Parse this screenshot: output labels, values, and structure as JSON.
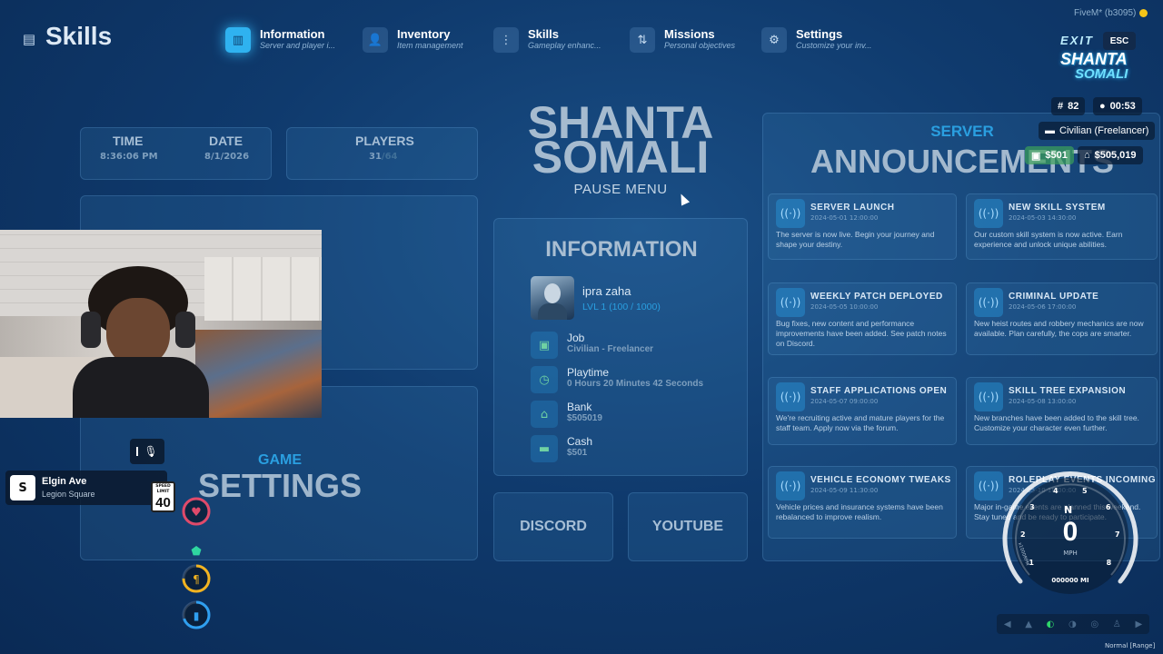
{
  "header": {
    "title": "Skills"
  },
  "nav": [
    {
      "label": "Information",
      "sub": "Server and player i...",
      "icon": "map-icon",
      "active": true
    },
    {
      "label": "Inventory",
      "sub": "Item management",
      "icon": "user-icon",
      "active": false
    },
    {
      "label": "Skills",
      "sub": "Gameplay enhanc...",
      "icon": "skills-icon",
      "active": false
    },
    {
      "label": "Missions",
      "sub": "Personal objectives",
      "icon": "route-icon",
      "active": false
    },
    {
      "label": "Settings",
      "sub": "Customize your inv...",
      "icon": "gear-icon",
      "active": false
    }
  ],
  "stats": {
    "time_label": "TIME",
    "time_value": "8:36:06 PM",
    "date_label": "DATE",
    "date_value": "8/1/2026",
    "players_label": "PLAYERS",
    "players_value": "31",
    "players_max": "/64"
  },
  "brand": {
    "line1": "SHANTA",
    "line2": "SOMALI",
    "subtitle": "PAUSE MENU"
  },
  "info": {
    "title": "INFORMATION",
    "name": "ipra zaha",
    "level": "LVL 1 (100 / 1000)",
    "rows": [
      {
        "label": "Job",
        "value": "Civilian - Freelancer",
        "icon": "briefcase-icon"
      },
      {
        "label": "Playtime",
        "value": "0 Hours 20 Minutes 42 Seconds",
        "icon": "clock-icon"
      },
      {
        "label": "Bank",
        "value": "$505019",
        "icon": "bank-icon"
      },
      {
        "label": "Cash",
        "value": "$501",
        "icon": "cash-icon"
      }
    ]
  },
  "links": {
    "discord": "DISCORD",
    "youtube": "YOUTUBE"
  },
  "game_settings": {
    "small": "GAME",
    "big": "SETTINGS"
  },
  "announcements": {
    "small": "SERVER",
    "big": "ANNOUNCEMENTS",
    "items": [
      {
        "title": "SERVER LAUNCH",
        "date": "2024-05-01 12:00:00",
        "body": "The server is now live. Begin your journey and shape your destiny."
      },
      {
        "title": "NEW SKILL SYSTEM",
        "date": "2024-05-03 14:30:00",
        "body": "Our custom skill system is now active. Earn experience and unlock unique abilities."
      },
      {
        "title": "WEEKLY PATCH DEPLOYED",
        "date": "2024-05-05 10:00:00",
        "body": "Bug fixes, new content and performance improvements have been added. See patch notes on Discord."
      },
      {
        "title": "CRIMINAL UPDATE",
        "date": "2024-05-06 17:00:00",
        "body": "New heist routes and robbery mechanics are now available. Plan carefully, the cops are smarter."
      },
      {
        "title": "STAFF APPLICATIONS OPEN",
        "date": "2024-05-07 09:00:00",
        "body": "We're recruiting active and mature players for the staff team. Apply now via the forum."
      },
      {
        "title": "SKILL TREE EXPANSION",
        "date": "2024-05-08 13:00:00",
        "body": "New branches have been added to the skill tree. Customize your character even further."
      },
      {
        "title": "VEHICLE ECONOMY TWEAKS",
        "date": "2024-05-09 11:30:00",
        "body": "Vehicle prices and insurance systems have been rebalanced to improve realism."
      },
      {
        "title": "ROLEPLAY EVENTS INCOMING",
        "date": "2024-05-10 18:00:00",
        "body": "Major in-game events are planned this weekend. Stay tuned and be ready to participate."
      }
    ]
  },
  "hud": {
    "fivem": "FiveM* (b3095)",
    "esc": "ESC",
    "exit": "EXIT",
    "logo_line1": "SHANTA",
    "logo_line2": "SOMALI",
    "id": "82",
    "clock": "00:53",
    "job": "Civilian (Freelancer)",
    "cash": "$501",
    "bank": "$505,019",
    "street": "Elgin Ave",
    "area": "Legion Square",
    "compass": "S",
    "speed_limit_label": "SPEED LIMIT",
    "speed_limit": "40",
    "speed": "0",
    "speed_unit": "MPH",
    "odometer": "000000 MI",
    "rpm_label": "x1000RPM",
    "gear": "N",
    "rpm_ticks": [
      "1",
      "2",
      "3",
      "4",
      "5",
      "6",
      "7",
      "8"
    ],
    "vehicle_mode": "Normal [Range]",
    "status": [
      {
        "icon": "heart-icon",
        "color": "#e04a6a",
        "level": 1.0
      },
      {
        "icon": "shield-icon",
        "color": "#2fd6a0",
        "level": 0.0
      },
      {
        "icon": "food-icon",
        "color": "#f2b320",
        "level": 0.75
      },
      {
        "icon": "water-icon",
        "color": "#2f9ff0",
        "level": 0.7
      }
    ]
  },
  "colors": {
    "accent": "#2fb2f0",
    "heart": "#e04a6a",
    "food": "#f2b320",
    "water": "#2f9ff0",
    "armor": "#2fd6a0"
  }
}
